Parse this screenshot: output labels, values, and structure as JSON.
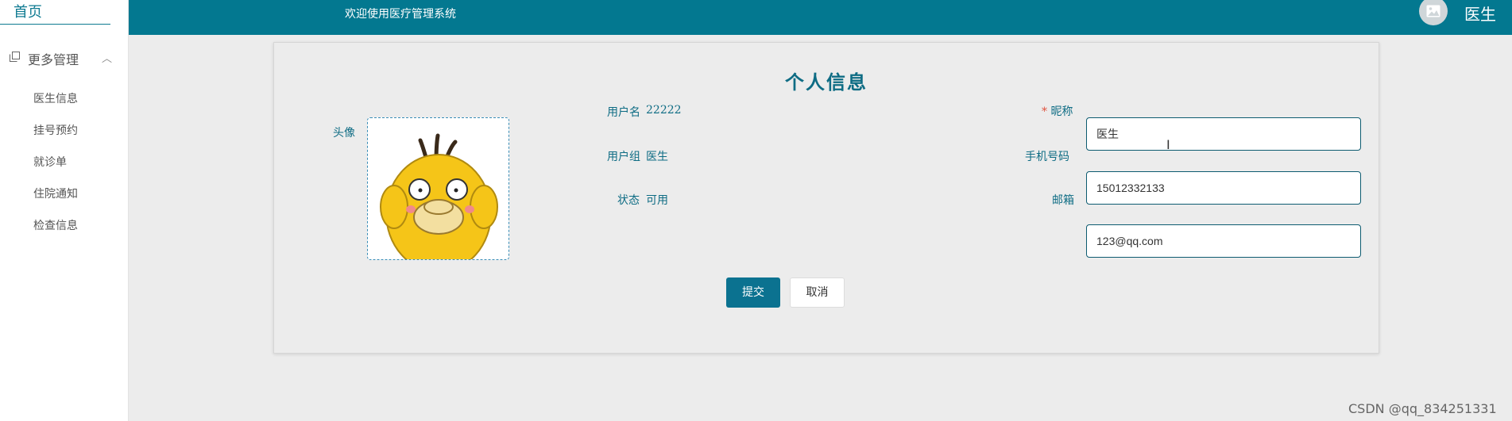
{
  "sidebar": {
    "home": "首页",
    "group_label": "更多管理",
    "items": [
      "医生信息",
      "挂号预约",
      "就诊单",
      "住院通知",
      "检查信息"
    ]
  },
  "topbar": {
    "welcome": "欢迎使用医疗管理系统",
    "user": "医生"
  },
  "profile": {
    "title": "个人信息",
    "avatar_label": "头像",
    "username_label": "用户名",
    "username_value": "22222",
    "usergroup_label": "用户组",
    "usergroup_value": "医生",
    "status_label": "状态",
    "status_value": "可用",
    "nickname_label": "昵称",
    "nickname_value": "医生",
    "phone_label": "手机号码",
    "phone_value": "15012332133",
    "email_label": "邮箱",
    "email_value": "123@qq.com",
    "submit_label": "提交",
    "cancel_label": "取消"
  },
  "watermark": "CSDN @qq_834251331",
  "colors": {
    "primary": "#037890",
    "label": "#0e6c84",
    "required": "#e0533f"
  }
}
